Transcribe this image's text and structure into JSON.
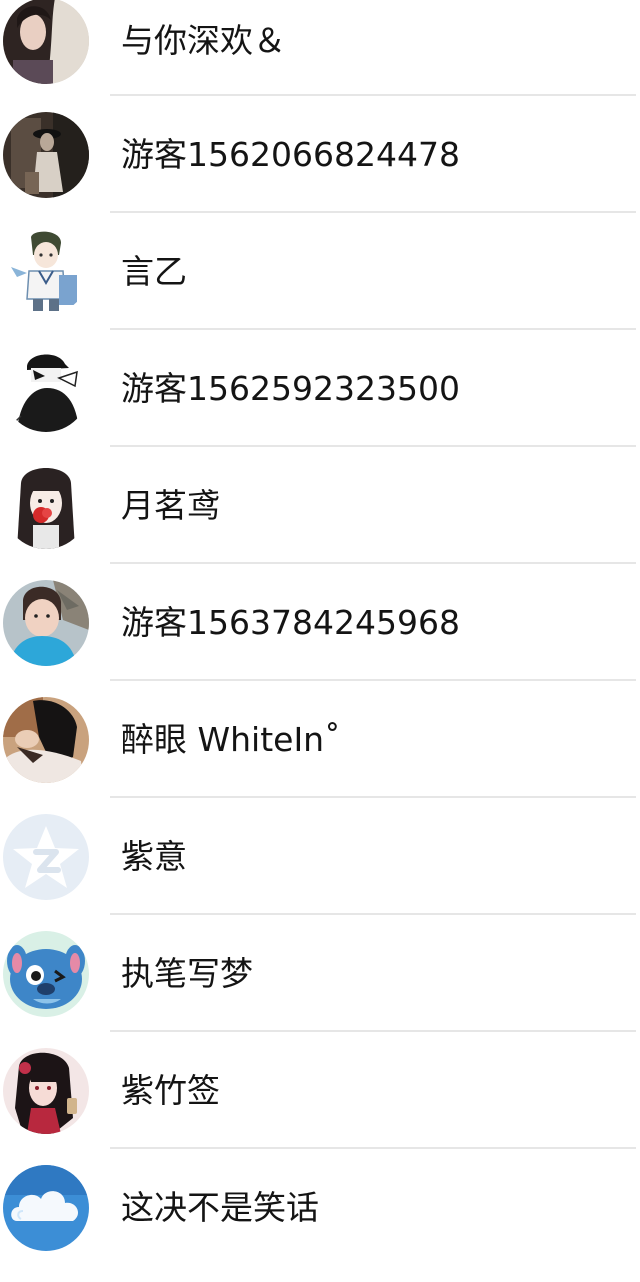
{
  "contacts": [
    {
      "name": "与你深欢＆",
      "avatar_icon": "girl-dark-hair-photo-avatar"
    },
    {
      "name": "游客1562066824478",
      "avatar_icon": "woman-hat-sepia-photo-avatar"
    },
    {
      "name": "言乙",
      "avatar_icon": "anime-boy-sailor-avatar"
    },
    {
      "name": "游客1562592323500",
      "avatar_icon": "black-cap-sketch-avatar"
    },
    {
      "name": "月茗鸢",
      "avatar_icon": "anime-girl-red-flower-avatar"
    },
    {
      "name": "游客1563784245968",
      "avatar_icon": "child-photo-avatar"
    },
    {
      "name": "醉眼 WhiteIn˚",
      "avatar_icon": "person-lying-photo-avatar"
    },
    {
      "name": "紫意",
      "avatar_icon": "default-star-avatar"
    },
    {
      "name": "执笔写梦",
      "avatar_icon": "blue-cartoon-stitch-avatar"
    },
    {
      "name": "紫竹签",
      "avatar_icon": "anime-girl-black-hair-avatar"
    },
    {
      "name": "这决不是笑话",
      "avatar_icon": "cloud-sky-avatar"
    }
  ],
  "colors": {
    "text": "#141414",
    "divider": "#e6e6e6",
    "background": "#ffffff"
  }
}
